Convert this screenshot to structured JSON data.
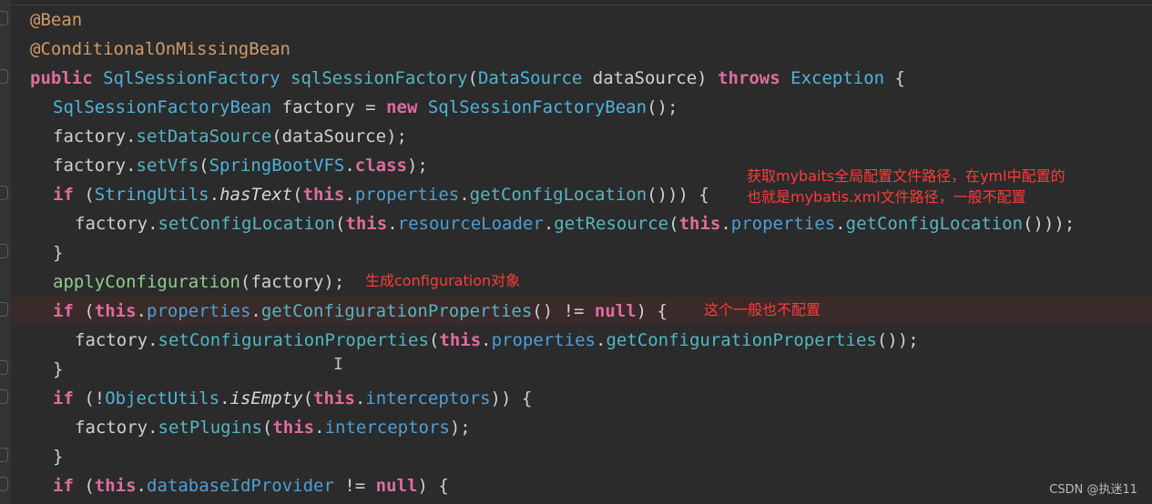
{
  "code": {
    "l1": {
      "ann": "@Bean"
    },
    "l2": {
      "ann": "@ConditionalOnMissingBean"
    },
    "l3": {
      "kw1": "public",
      "type1": "SqlSessionFactory",
      "method": "sqlSessionFactory",
      "p1": "(",
      "type2": "DataSource",
      "p2": " dataSource) ",
      "kw2": "throws",
      "type3": "Exception",
      "p3": " {"
    },
    "l4": {
      "type1": "SqlSessionFactoryBean",
      "p1": " factory = ",
      "kw1": "new",
      "type2": "SqlSessionFactoryBean",
      "p2": "();"
    },
    "l5": {
      "p1": "factory.",
      "m1": "setDataSource",
      "p2": "(dataSource);"
    },
    "l6": {
      "p1": "factory.",
      "m1": "setVfs",
      "p2": "(",
      "type1": "SpringBootVFS",
      "p3": ".",
      "kw1": "class",
      "p4": ");"
    },
    "l7": {
      "kw1": "if",
      "p1": " (",
      "type1": "StringUtils",
      "p2": ".",
      "it1": "hasText",
      "p3": "(",
      "kw2": "this",
      "p4": ".",
      "f1": "properties",
      "p5": ".",
      "m1": "getConfigLocation",
      "p6": "())) {"
    },
    "l8": {
      "p1": "factory.",
      "m1": "setConfigLocation",
      "p2": "(",
      "kw1": "this",
      "p3": ".",
      "f1": "resourceLoader",
      "p4": ".",
      "m2": "getResource",
      "p5": "(",
      "kw2": "this",
      "p6": ".",
      "f2": "properties",
      "p7": ".",
      "m3": "getConfigLocation",
      "p8": "()));"
    },
    "l9": {
      "p1": "}"
    },
    "l10": {
      "apply": "applyConfiguration",
      "p1": "(factory);"
    },
    "l11": {
      "kw1": "if",
      "p1": " (",
      "kw2": "this",
      "p2": ".",
      "f1": "properties",
      "p3": ".",
      "m1": "getConfigurationProperties",
      "p4": "() != ",
      "kw3": "null",
      "p5": ") {"
    },
    "l12": {
      "p1": "factory.",
      "m1": "setConfigurationProperties",
      "p2": "(",
      "kw1": "this",
      "p3": ".",
      "f1": "properties",
      "p4": ".",
      "m2": "getConfigurationProperties",
      "p5": "());"
    },
    "l13": {
      "p1": "}"
    },
    "l14": {
      "kw1": "if",
      "p1": " (!",
      "type1": "ObjectUtils",
      "p2": ".",
      "it1": "isEmpty",
      "p3": "(",
      "kw2": "this",
      "p4": ".",
      "f1": "interceptors",
      "p5": ")) {"
    },
    "l15": {
      "p1": "factory.",
      "m1": "setPlugins",
      "p2": "(",
      "kw1": "this",
      "p3": ".",
      "f1": "interceptors",
      "p4": ");"
    },
    "l16": {
      "p1": "}"
    },
    "l17": {
      "kw1": "if",
      "p1": " (",
      "kw2": "this",
      "p2": ".",
      "f1": "databaseIdProvider",
      "p3": " != ",
      "kw3": "null",
      "p4": ") {"
    }
  },
  "annotations": {
    "note1_line1": "获取mybaits全局配置文件路径，在yml中配置的",
    "note1_line2": "也就是mybatis.xml文件路径，一般不配置",
    "note2": "生成configuration对象",
    "note3": "这个一般也不配置"
  },
  "cursor": "I",
  "watermark": "CSDN @执迷11"
}
